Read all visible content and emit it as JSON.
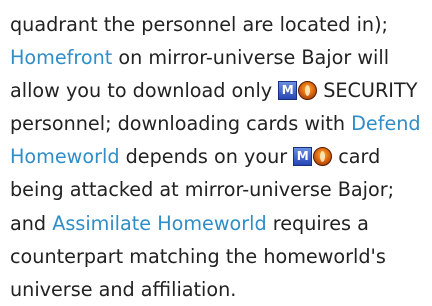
{
  "icons": {
    "mirror_icon": "M",
    "mirror_icon_color": "#2747b6",
    "orb_icon_color": "#e06c10"
  },
  "text": {
    "l1": "quadrant the personnel are located in);",
    "l2_link": "Homefront",
    "l2_rest": " on mirror-universe Bajor will",
    "l3_pre": "allow you to download only ",
    "l3_post": "SECURITY",
    "l4": "personnel; downloading cards with ",
    "l4_link": "Defend",
    "l5_link": "Homeworld",
    "l5_pre": " depends on your ",
    "l5_post": "card",
    "l6": "being attacked at mirror-universe Bajor;",
    "l7_pre": "and ",
    "l7_link": "Assimilate Homeworld",
    "l7_post": " requires a",
    "l8": "counterpart matching the homeworld's",
    "l9": "universe and affiliation."
  },
  "colors": {
    "link": "#2f8dc7",
    "text": "#222222"
  }
}
